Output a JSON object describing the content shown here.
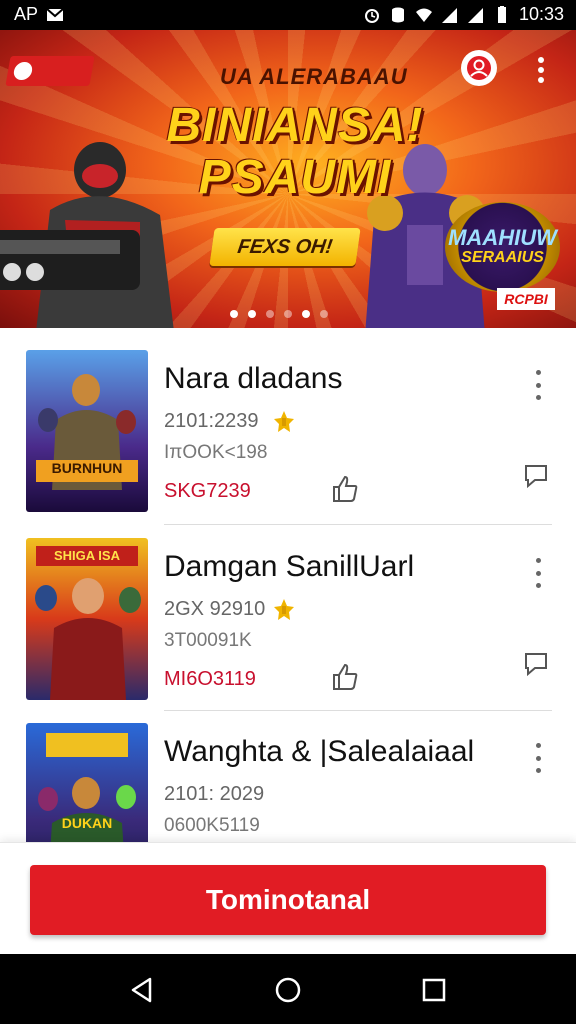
{
  "status_bar": {
    "left_text": "AP",
    "time": "10:33",
    "icons": [
      "mail-icon",
      "alarm-icon",
      "data-icon",
      "wifi-icon",
      "signal-icon",
      "signal-icon",
      "battery-icon"
    ]
  },
  "banner": {
    "brand_badge": "",
    "small_title": "UA ALERABAAU",
    "title_line1": "BINIANSA!",
    "title_line2": "PSAUMI",
    "cta": "FEXS OH!",
    "emblem_line1": "MAAHIUW",
    "emblem_line2": "SERAAIUS",
    "emblem_line3": "",
    "tag": "RCPBI",
    "carousel": {
      "total": 6,
      "active": 4
    },
    "colors": {
      "primary": "#e11c24",
      "gold": "#ffd21a"
    }
  },
  "items": [
    {
      "title": "Nara dladans",
      "meta1": "2101:2239",
      "meta2": "IπOOK<198",
      "price": "SKG7239",
      "thumb_title": "BURNHUN",
      "thumb_colors": [
        "#f0a020",
        "#4a2a8a",
        "#1a0a3a"
      ]
    },
    {
      "title": "Damgan SanillUarl",
      "meta1": "2GX 92910",
      "meta2": "3T00091K",
      "price": "MI6O3119",
      "thumb_title": "SHIGA ISA",
      "thumb_colors": [
        "#d83a1a",
        "#f0c020",
        "#2a2a6a"
      ]
    },
    {
      "title": "Wanghta & |Salealaiaal",
      "meta1": "2101: 2029",
      "meta2": "0600K5119",
      "price": "",
      "thumb_title": "DUKAN",
      "thumb_colors": [
        "#2a6ad8",
        "#f0c020",
        "#1a1a4a"
      ]
    }
  ],
  "action_button": {
    "label": "Tominotanal"
  },
  "nav": {
    "back": "back-icon",
    "home": "home-icon",
    "recents": "recents-icon"
  }
}
